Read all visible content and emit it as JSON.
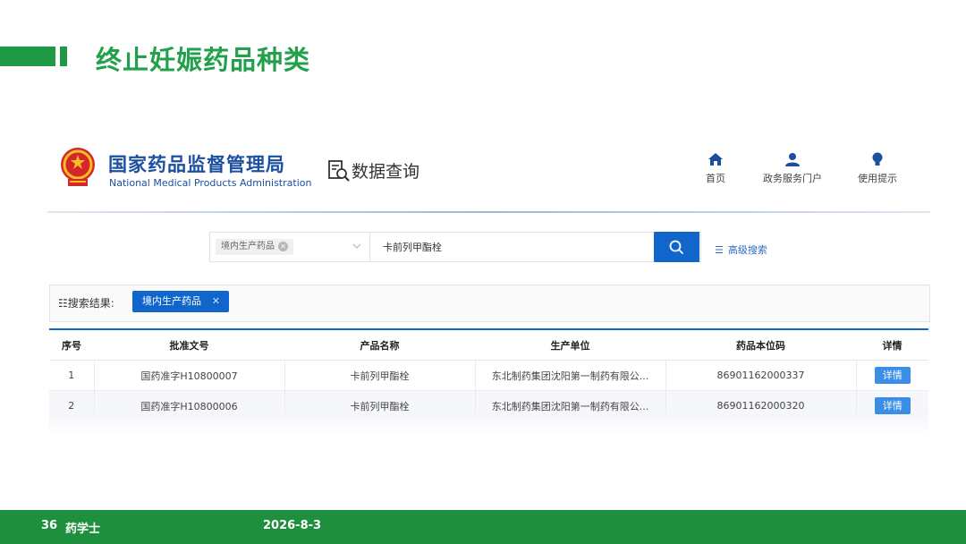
{
  "slide": {
    "title": "终止妊娠药品种类"
  },
  "header": {
    "org_name_cn": "国家药品监督管理局",
    "org_name_en": "National Medical Products Administration",
    "section": "数据查询",
    "nav": [
      {
        "label": "首页",
        "icon": "home-icon"
      },
      {
        "label": "政务服务门户",
        "icon": "user-icon"
      },
      {
        "label": "使用提示",
        "icon": "lightbulb-icon"
      }
    ]
  },
  "search": {
    "category": "境内生产药品",
    "query": "卡前列甲酯栓",
    "advanced_label": "高级搜索"
  },
  "results": {
    "label": "搜索结果:",
    "chip": "境内生产药品"
  },
  "table": {
    "columns": [
      "序号",
      "批准文号",
      "产品名称",
      "生产单位",
      "药品本位码",
      "详情"
    ],
    "rows": [
      {
        "index": "1",
        "approval": "国药准字H10800007",
        "product": "卡前列甲酯栓",
        "maker": "东北制药集团沈阳第一制药有限公...",
        "code": "86901162000337",
        "detail": "详情"
      },
      {
        "index": "2",
        "approval": "国药准字H10800006",
        "product": "卡前列甲酯栓",
        "maker": "东北制药集团沈阳第一制药有限公...",
        "code": "86901162000320",
        "detail": "详情"
      }
    ]
  },
  "footer": {
    "page": "36",
    "brand": "药学士",
    "date": "2026-8-3"
  },
  "colors": {
    "green": "#1e9a46",
    "blue": "#1166cc",
    "footer": "#1e8f3d"
  }
}
